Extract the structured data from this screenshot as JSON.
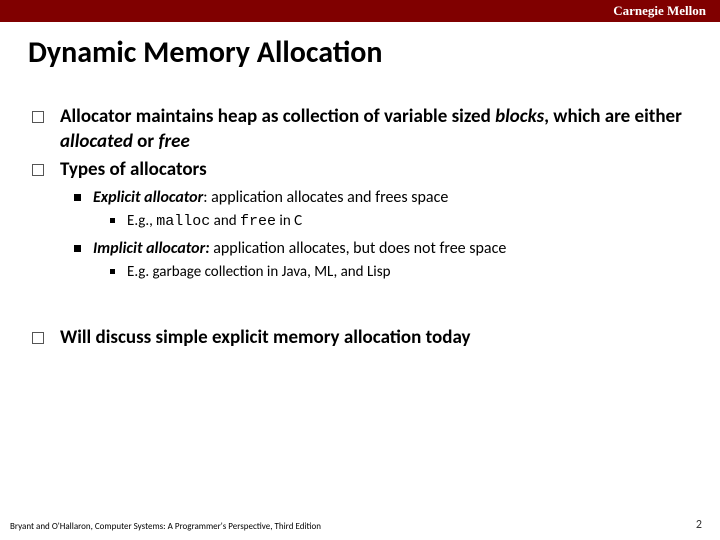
{
  "header": {
    "brand": "Carnegie Mellon"
  },
  "title": "Dynamic Memory Allocation",
  "bullets": {
    "b1_pre": "Allocator maintains heap as collection of variable sized ",
    "b1_em1": "blocks",
    "b1_mid": ", which are either ",
    "b1_em2": "allocated",
    "b1_mid2": " or ",
    "b1_em3": "free",
    "b2": "Types of allocators",
    "b2a_lead": "Explicit allocator",
    "b2a_rest": ":  application allocates and frees space",
    "b2a1_pre": "E.g., ",
    "b2a1_m1": "malloc",
    "b2a1_mid": " and ",
    "b2a1_m2": "free",
    "b2a1_post": " in C",
    "b2b_lead": "Implicit allocator:",
    "b2b_rest": " application allocates, but does not free space",
    "b2b1": "E.g. garbage collection in Java, ML, and Lisp",
    "b3": "Will discuss simple explicit memory allocation today"
  },
  "footer": {
    "citation": "Bryant and O'Hallaron, Computer Systems: A Programmer's Perspective, Third Edition",
    "page": "2"
  }
}
